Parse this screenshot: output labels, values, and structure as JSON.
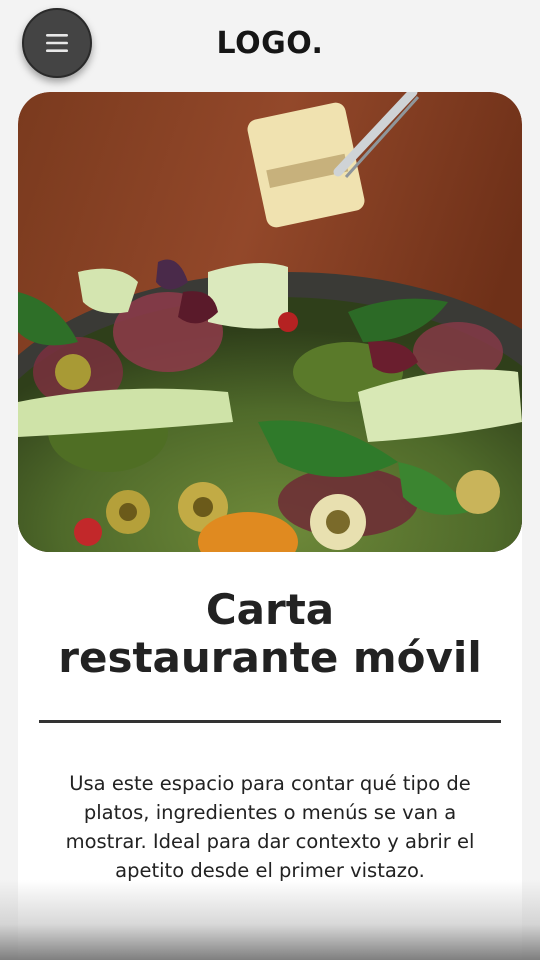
{
  "header": {
    "menu_icon": "hamburger-menu-icon",
    "logo_text": "LOGO."
  },
  "hero": {
    "image_subject": "food-photo"
  },
  "content": {
    "title_line1": "Carta",
    "title_line2": "restaurante móvil",
    "description": "Usa este espacio para contar qué tipo de platos, ingredientes o menús se van a mostrar. Ideal para dar contexto y abrir el apetito desde el primer vistazo."
  },
  "colors": {
    "menu_button": "#444444",
    "text": "#222222",
    "card": "#ffffff",
    "page_bg": "#f3f3f3"
  }
}
